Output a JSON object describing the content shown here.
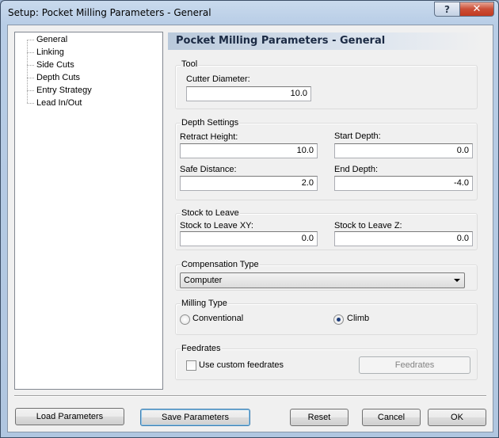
{
  "window": {
    "title": "Setup: Pocket Milling Parameters - General",
    "help_label": "?",
    "close_label": "✕"
  },
  "tree": {
    "items": [
      "General",
      "Linking",
      "Side Cuts",
      "Depth Cuts",
      "Entry Strategy",
      "Lead In/Out"
    ]
  },
  "header": {
    "title": "Pocket Milling Parameters - General"
  },
  "tool": {
    "group_label": "Tool",
    "cutter_diameter_label": "Cutter Diameter:",
    "cutter_diameter_value": "10.0"
  },
  "depth": {
    "group_label": "Depth Settings",
    "retract_label": "Retract Height:",
    "retract_value": "10.0",
    "start_label": "Start Depth:",
    "start_value": "0.0",
    "safe_label": "Safe Distance:",
    "safe_value": "2.0",
    "end_label": "End Depth:",
    "end_value": "-4.0"
  },
  "stock": {
    "group_label": "Stock to Leave",
    "xy_label": "Stock to Leave XY:",
    "xy_value": "0.0",
    "z_label": "Stock to Leave Z:",
    "z_value": "0.0"
  },
  "compensation": {
    "group_label": "Compensation Type",
    "selected": "Computer"
  },
  "milling": {
    "group_label": "Milling Type",
    "conventional_label": "Conventional",
    "climb_label": "Climb",
    "selected": "climb"
  },
  "feedrates": {
    "group_label": "Feedrates",
    "custom_label": "Use custom feedrates",
    "custom_checked": false,
    "button_label": "Feedrates"
  },
  "buttons": {
    "load": "Load Parameters",
    "save": "Save Parameters",
    "reset": "Reset",
    "cancel": "Cancel",
    "ok": "OK"
  }
}
